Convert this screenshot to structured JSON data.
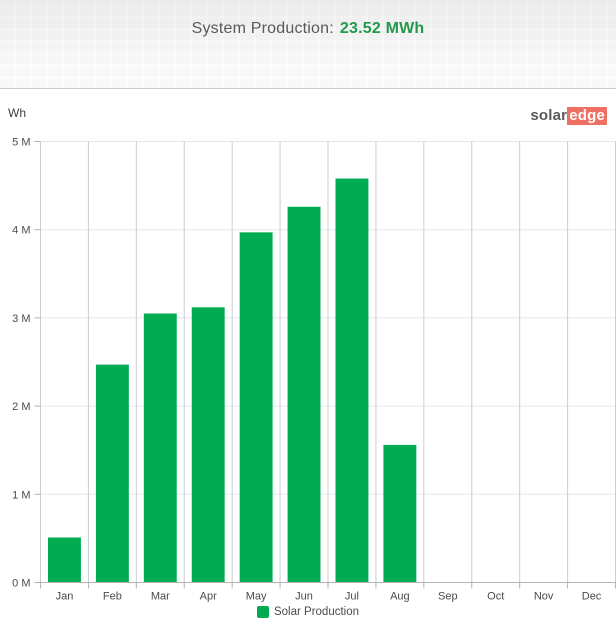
{
  "header": {
    "title_label": "System Production:",
    "title_value": "23.52 MWh"
  },
  "logo": {
    "part1": "solar",
    "part2": "edge"
  },
  "chart_data": {
    "type": "bar",
    "title": "System Production",
    "unit_label": "Wh",
    "categories": [
      "Jan",
      "Feb",
      "Mar",
      "Apr",
      "May",
      "Jun",
      "Jul",
      "Aug",
      "Sep",
      "Oct",
      "Nov",
      "Dec"
    ],
    "series": [
      {
        "name": "Solar Production",
        "values_mwh": [
          0.51,
          2.47,
          3.05,
          3.12,
          3.97,
          4.26,
          4.58,
          1.56,
          0,
          0,
          0,
          0
        ]
      }
    ],
    "total_mwh": "23.52 MWh",
    "xlabel": "",
    "ylabel": "Wh",
    "ylim_mwh": [
      0,
      5
    ],
    "ytick_labels": [
      "0 M",
      "1 M",
      "2 M",
      "3 M",
      "4 M",
      "5 M"
    ],
    "grid": true,
    "legend_position": "bottom-center",
    "legend": [
      "Solar Production"
    ]
  },
  "colors": {
    "bar": "#00ab51",
    "title_value_green": "#21994c",
    "logo_red": "#ee6f64",
    "h_gridline": "#dde8f1",
    "v_gridline": "#cdcdcd",
    "axis_line": "#b3b3b3",
    "tick_label": "#4a4a4a"
  }
}
